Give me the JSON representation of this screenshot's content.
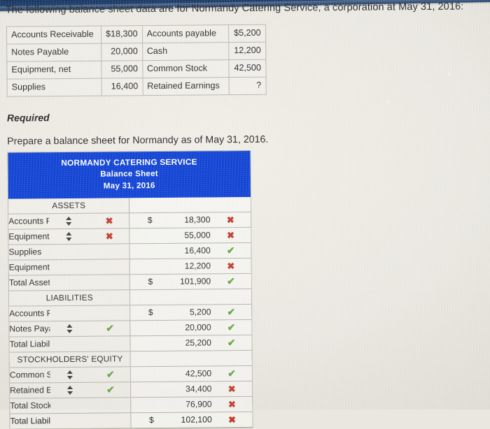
{
  "prompt": "The following balance sheet data are for Normandy Catering Service, a corporation at May 31, 2016:",
  "given_table": {
    "rows": [
      {
        "label_left": "Accounts Receivable",
        "amount_left": "$18,300",
        "label_right": "Accounts payable",
        "amount_right": "$5,200"
      },
      {
        "label_left": "Notes Payable",
        "amount_left": "20,000",
        "label_right": "Cash",
        "amount_right": "12,200"
      },
      {
        "label_left": "Equipment, net",
        "amount_left": "55,000",
        "label_right": "Common Stock",
        "amount_right": "42,500"
      },
      {
        "label_left": "Supplies",
        "amount_left": "16,400",
        "label_right": "Retained Earnings",
        "amount_right": "?"
      }
    ]
  },
  "required": {
    "heading": "Required",
    "text": "Prepare a balance sheet for Normandy as of May 31, 2016."
  },
  "balance_sheet": {
    "header": {
      "company": "NORMANDY CATERING SERVICE",
      "statement": "Balance Sheet",
      "date": "May 31, 2016",
      "background_color": "#0c3fd4",
      "text_color": "#ffffff"
    },
    "marks": {
      "correct_glyph": "✔",
      "incorrect_glyph": "✖",
      "correct_color": "#61a544",
      "incorrect_color": "#c0392b"
    },
    "sections": [
      {
        "title": "ASSETS",
        "rows": [
          {
            "label": "Accounts Receivable",
            "indent": 0,
            "has_stepper": true,
            "label_mark": "incorrect",
            "dollar": "$",
            "amount": "18,300",
            "amount_mark": "incorrect"
          },
          {
            "label": "Equipment, net",
            "indent": 0,
            "has_stepper": true,
            "label_mark": "incorrect",
            "dollar": "",
            "amount": "55,000",
            "amount_mark": "incorrect"
          },
          {
            "label": "Supplies",
            "indent": 0,
            "has_stepper": false,
            "label_mark": "",
            "dollar": "",
            "amount": "16,400",
            "amount_mark": "correct"
          },
          {
            "label": "Equipment, net",
            "indent": 0,
            "has_stepper": false,
            "label_mark": "",
            "dollar": "",
            "amount": "12,200",
            "amount_mark": "incorrect"
          },
          {
            "label": "Total Assets",
            "indent": 1,
            "has_stepper": false,
            "label_mark": "",
            "dollar": "$",
            "amount": "101,900",
            "amount_mark": "correct"
          }
        ]
      },
      {
        "title": "LIABILITIES",
        "rows": [
          {
            "label": "Accounts Payable",
            "indent": 0,
            "has_stepper": false,
            "label_mark": "",
            "dollar": "$",
            "amount": "5,200",
            "amount_mark": "correct"
          },
          {
            "label": "Notes Payable",
            "indent": 0,
            "has_stepper": true,
            "label_mark": "correct",
            "dollar": "",
            "amount": "20,000",
            "amount_mark": "correct"
          },
          {
            "label": "Total Liabilities",
            "indent": 1,
            "has_stepper": false,
            "label_mark": "",
            "dollar": "",
            "amount": "25,200",
            "amount_mark": "correct"
          }
        ]
      },
      {
        "title": "STOCKHOLDERS' EQUITY",
        "rows": [
          {
            "label": "Common Stock",
            "indent": 0,
            "has_stepper": true,
            "label_mark": "correct",
            "dollar": "",
            "amount": "42,500",
            "amount_mark": "correct"
          },
          {
            "label": "Retained Earnings",
            "indent": 0,
            "has_stepper": true,
            "label_mark": "correct",
            "dollar": "",
            "amount": "34,400",
            "amount_mark": "incorrect"
          },
          {
            "label": "Total Stockholders' Equity",
            "indent": 1,
            "has_stepper": false,
            "label_mark": "",
            "dollar": "",
            "amount": "76,900",
            "amount_mark": "incorrect"
          },
          {
            "label": "Total Liabilities and Stockholders' Equity",
            "indent": 2,
            "has_stepper": false,
            "label_mark": "",
            "dollar": "$",
            "amount": "102,100",
            "amount_mark": "incorrect"
          }
        ]
      }
    ]
  }
}
